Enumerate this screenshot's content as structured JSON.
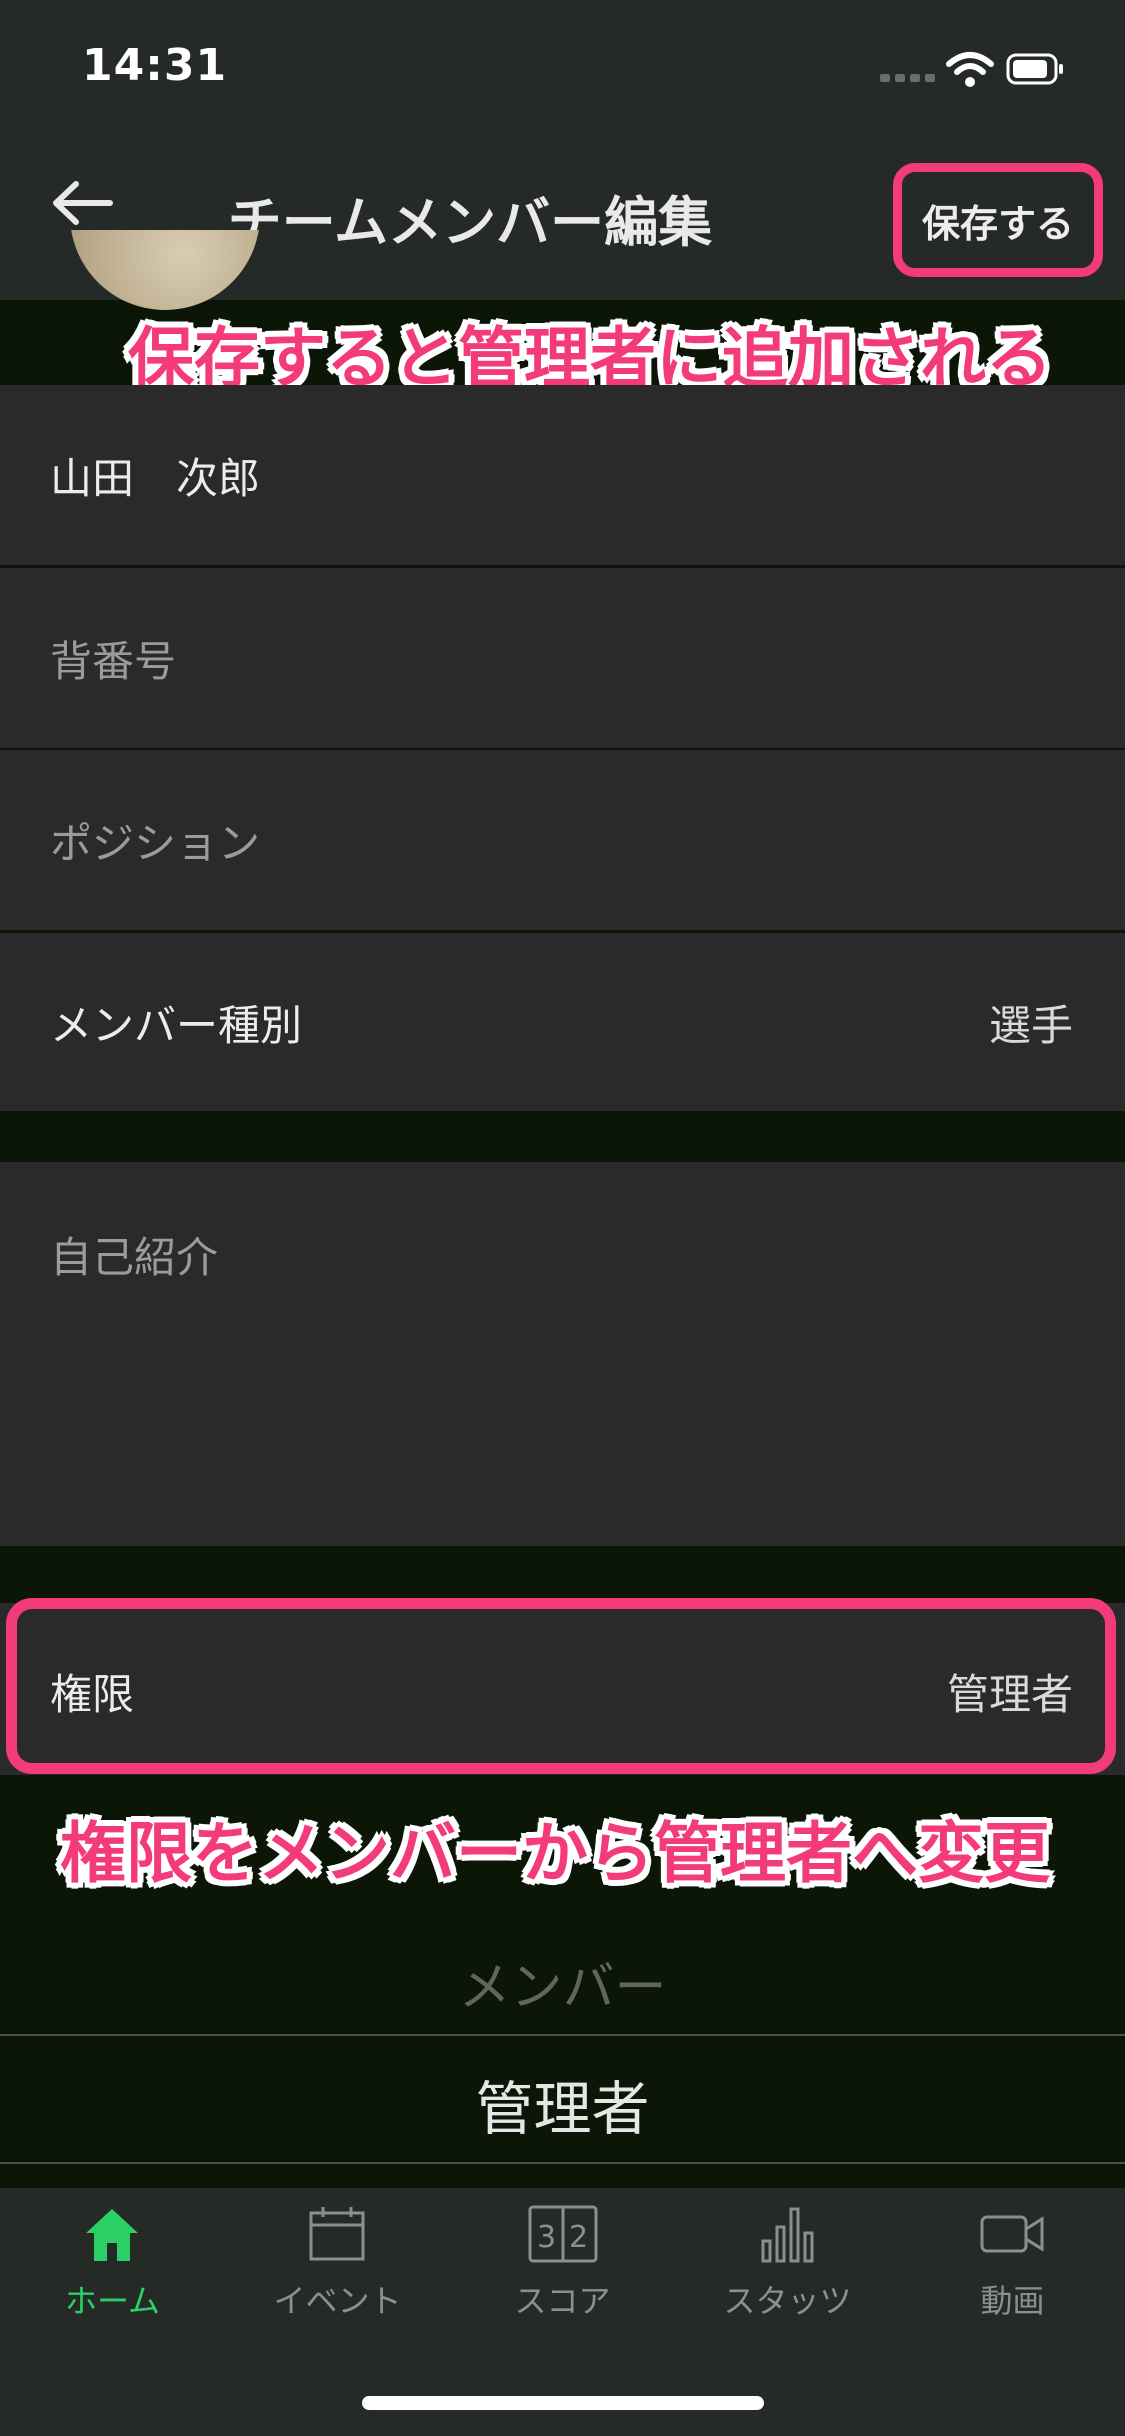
{
  "status": {
    "time": "14:31"
  },
  "header": {
    "title": "チームメンバー編集",
    "save_label": "保存する"
  },
  "annotations": {
    "top": "保存すると管理者に追加される",
    "middle": "権限をメンバーから管理者へ変更",
    "color": "#f23b78"
  },
  "form": {
    "name_value": "山田　次郎",
    "number_placeholder": "背番号",
    "position_placeholder": "ポジション",
    "member_type_label": "メンバー種別",
    "member_type_value": "選手",
    "bio_placeholder": "自己紹介",
    "permission_label": "権限",
    "permission_value": "管理者"
  },
  "picker": {
    "options": [
      "メンバー",
      "管理者"
    ],
    "selected": "管理者"
  },
  "tabs": [
    {
      "label": "ホーム",
      "icon": "home-icon",
      "active": true
    },
    {
      "label": "イベント",
      "icon": "calendar-icon",
      "active": false
    },
    {
      "label": "スコア",
      "icon": "scoreboard-icon",
      "active": false
    },
    {
      "label": "スタッツ",
      "icon": "bar-chart-icon",
      "active": false
    },
    {
      "label": "動画",
      "icon": "video-camera-icon",
      "active": false
    }
  ],
  "colors": {
    "accent": "#2bd066",
    "highlight": "#f23b78",
    "background": "#0b1607",
    "header": "#252a27"
  }
}
